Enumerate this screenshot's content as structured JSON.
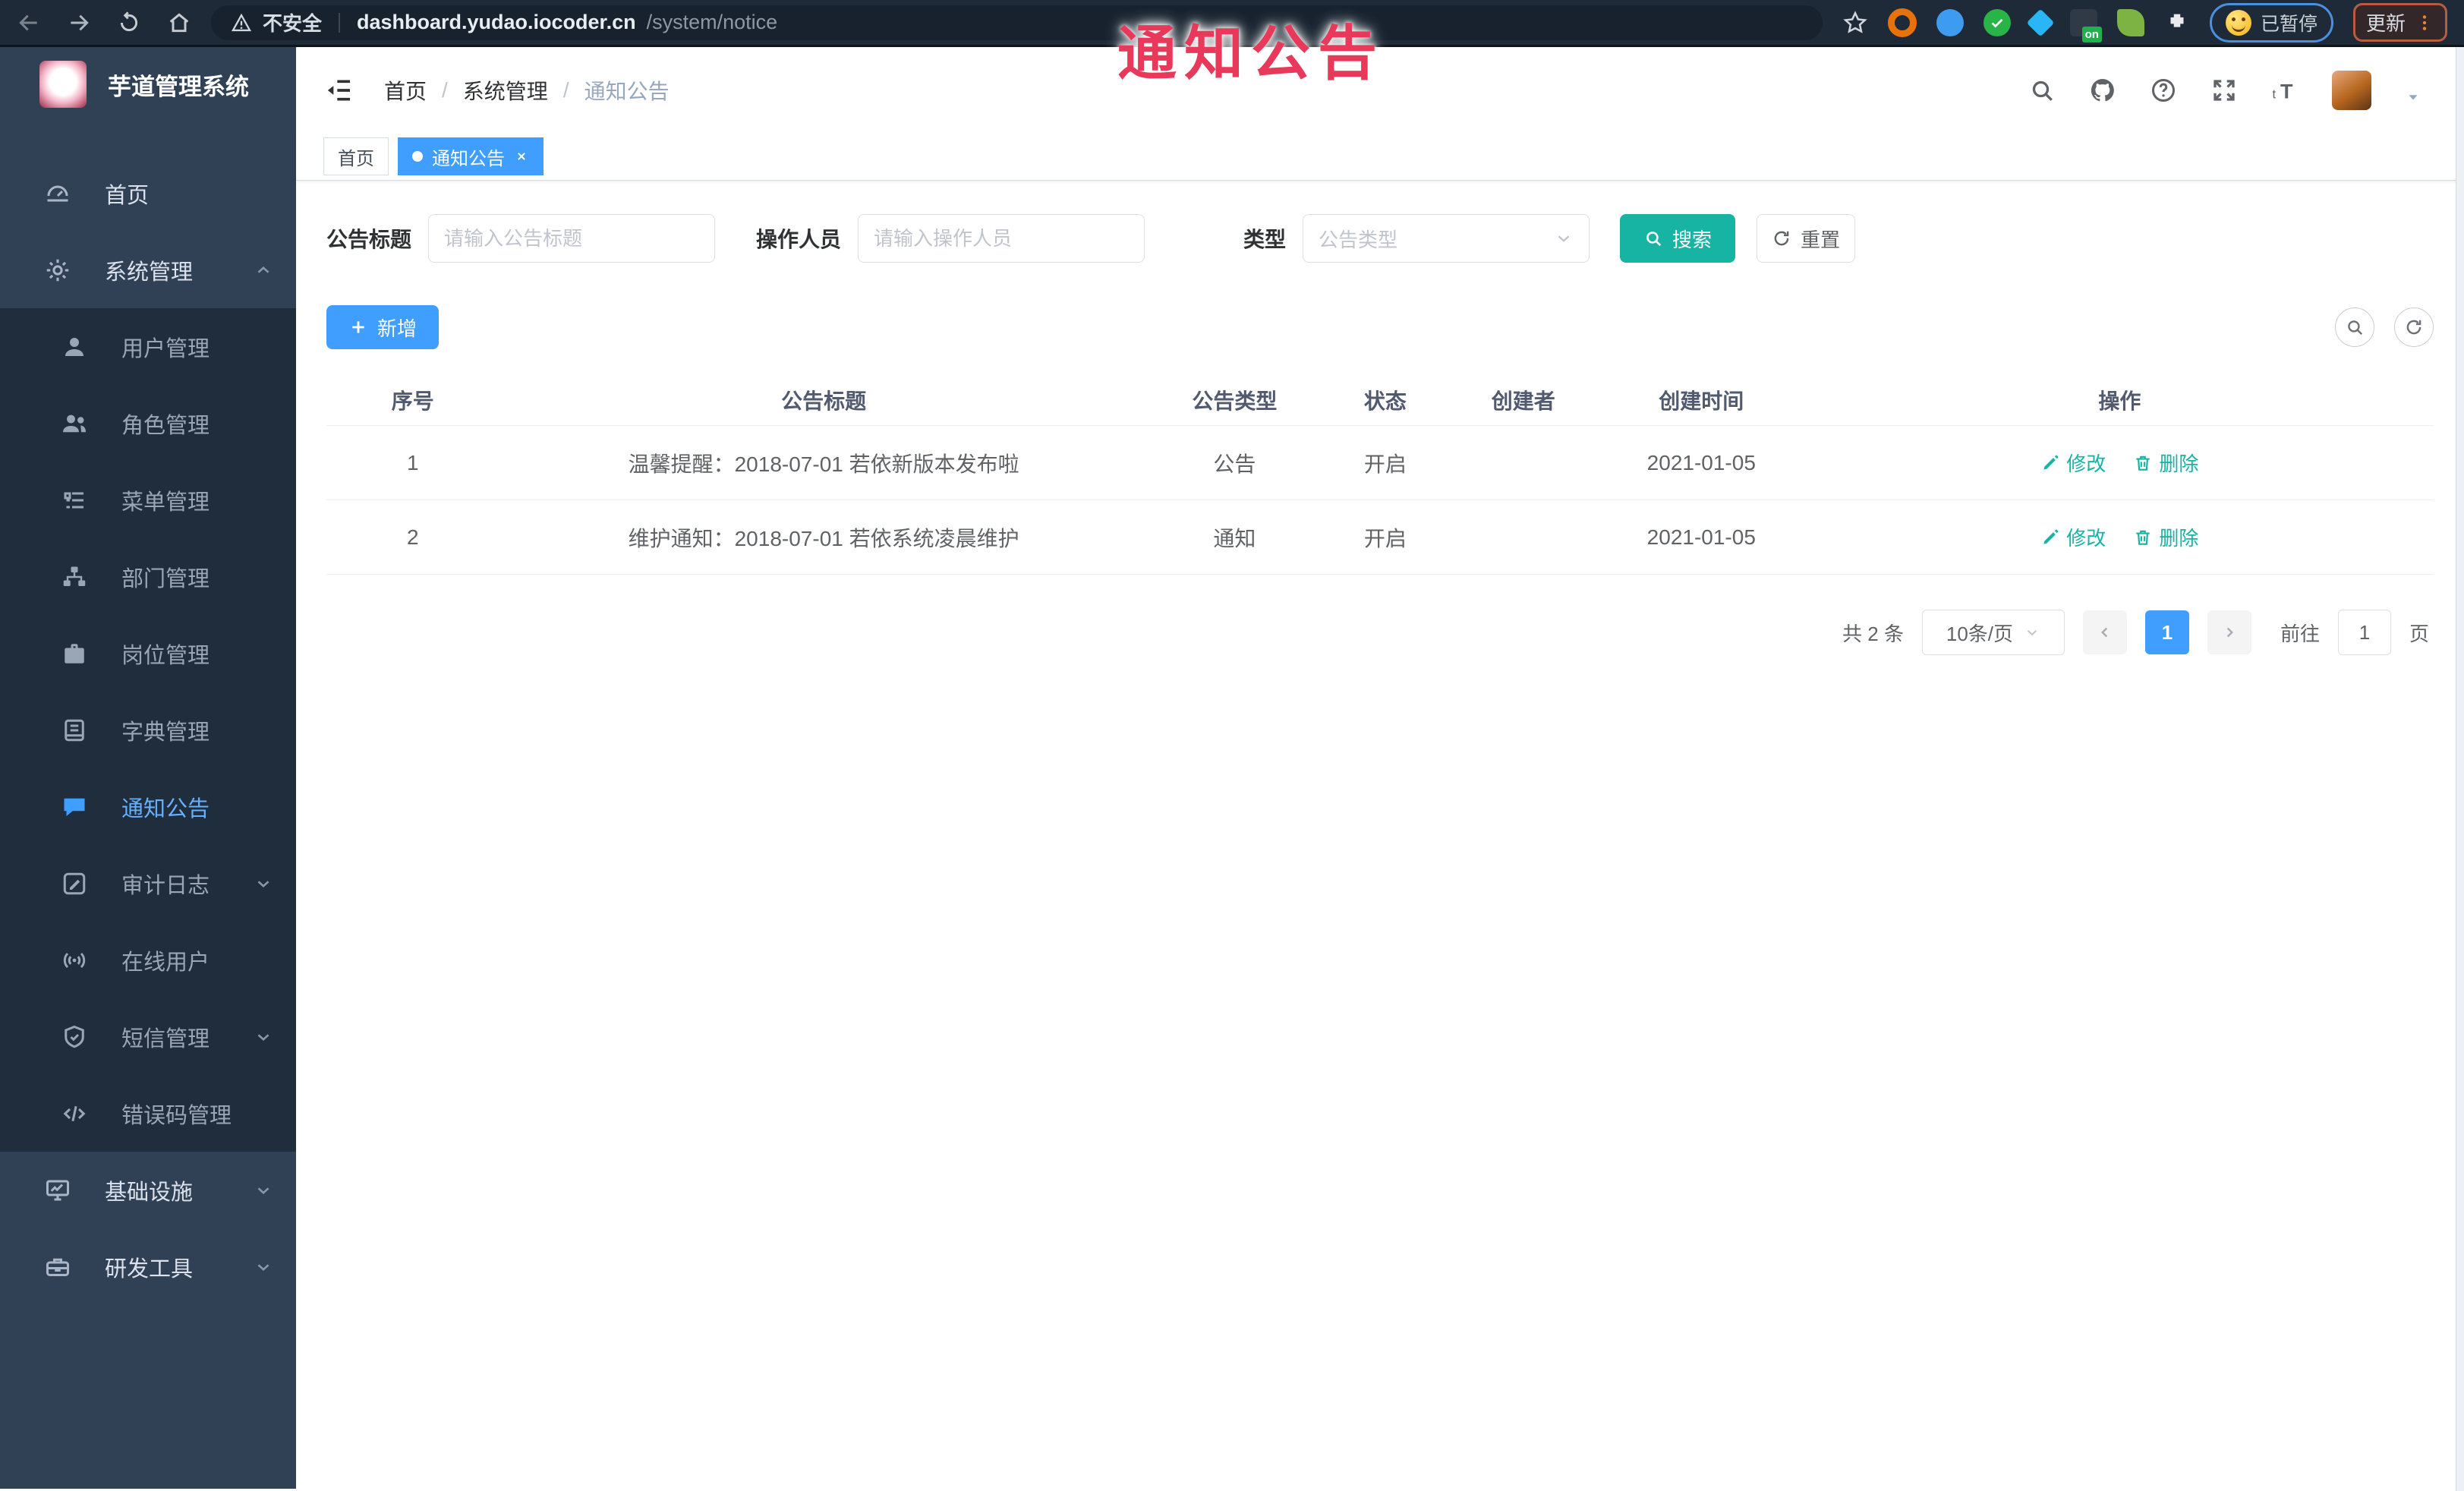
{
  "browser": {
    "security_label": "不安全",
    "url_host": "dashboard.yudao.iocoder.cn",
    "url_path": "/system/notice",
    "on_badge": "on",
    "paused_label": "已暂停",
    "update_label": "更新"
  },
  "overlay": {
    "text": "通知公告",
    "color": "#e8395a"
  },
  "sidebar": {
    "title": "芋道管理系统",
    "items": [
      {
        "label": "首页"
      },
      {
        "label": "系统管理"
      },
      {
        "label": "用户管理"
      },
      {
        "label": "角色管理"
      },
      {
        "label": "菜单管理"
      },
      {
        "label": "部门管理"
      },
      {
        "label": "岗位管理"
      },
      {
        "label": "字典管理"
      },
      {
        "label": "通知公告"
      },
      {
        "label": "审计日志"
      },
      {
        "label": "在线用户"
      },
      {
        "label": "短信管理"
      },
      {
        "label": "错误码管理"
      },
      {
        "label": "基础设施"
      },
      {
        "label": "研发工具"
      }
    ],
    "active_item": "通知公告"
  },
  "header": {
    "breadcrumb": [
      "首页",
      "系统管理",
      "通知公告"
    ],
    "separator": "/"
  },
  "tabs": [
    {
      "label": "首页",
      "active": false
    },
    {
      "label": "通知公告",
      "active": true
    }
  ],
  "filters": {
    "title_label": "公告标题",
    "title_placeholder": "请输入公告标题",
    "operator_label": "操作人员",
    "operator_placeholder": "请输入操作人员",
    "type_label": "类型",
    "type_placeholder": "公告类型",
    "search_label": "搜索",
    "reset_label": "重置"
  },
  "toolbar": {
    "add_label": "新增"
  },
  "table": {
    "columns": [
      "序号",
      "公告标题",
      "公告类型",
      "状态",
      "创建者",
      "创建时间",
      "操作"
    ],
    "rows": [
      {
        "index": "1",
        "title": "温馨提醒：2018-07-01 若依新版本发布啦",
        "type": "公告",
        "status": "开启",
        "creator": "",
        "create_time": "2021-01-05",
        "edit": "修改",
        "delete": "删除"
      },
      {
        "index": "2",
        "title": "维护通知：2018-07-01 若依系统凌晨维护",
        "type": "通知",
        "status": "开启",
        "creator": "",
        "create_time": "2021-01-05",
        "edit": "修改",
        "delete": "删除"
      }
    ]
  },
  "pagination": {
    "total": "共 2 条",
    "page_size": "10条/页",
    "current_page": "1",
    "goto_label": "前往",
    "goto_value": "1",
    "page_unit": "页"
  },
  "colors": {
    "primary": "#409EFF",
    "search_teal": "#17b3a3",
    "overlay_red": "#e8395a",
    "sidebar_bg": "#304156",
    "submenu_bg": "#1f2d3d",
    "browser_bar": "#1e2a37"
  }
}
